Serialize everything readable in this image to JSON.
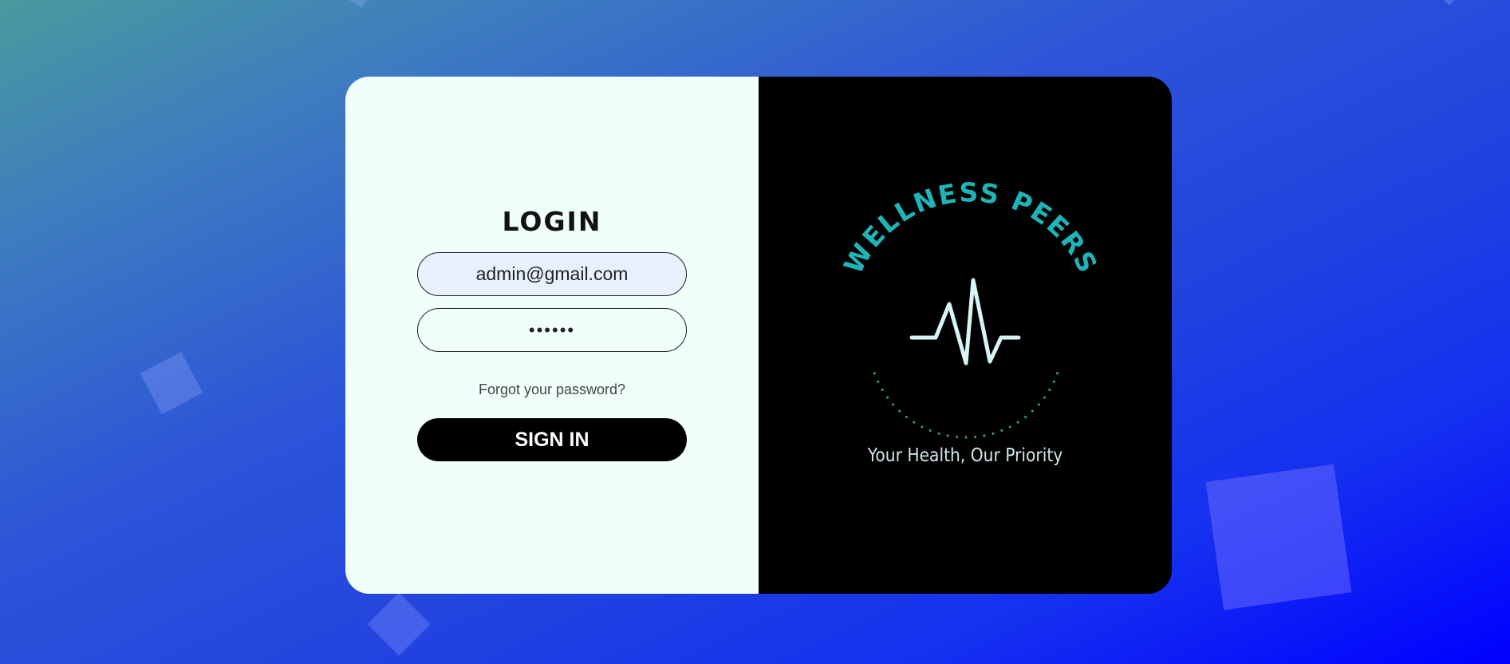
{
  "login": {
    "title": "LOGIN",
    "email_value": "admin@gmail.com",
    "password_value": "••••••",
    "forgot_label": "Forgot your password?",
    "signin_label": "SIGN IN"
  },
  "brand": {
    "name": "WELLNESS PEERS",
    "tagline": "Your Health, Our Priority",
    "logo_icon": "heartbeat-pulse-icon",
    "accent_color": "#1fb5b8",
    "pulse_color": "#d8f4f4"
  }
}
